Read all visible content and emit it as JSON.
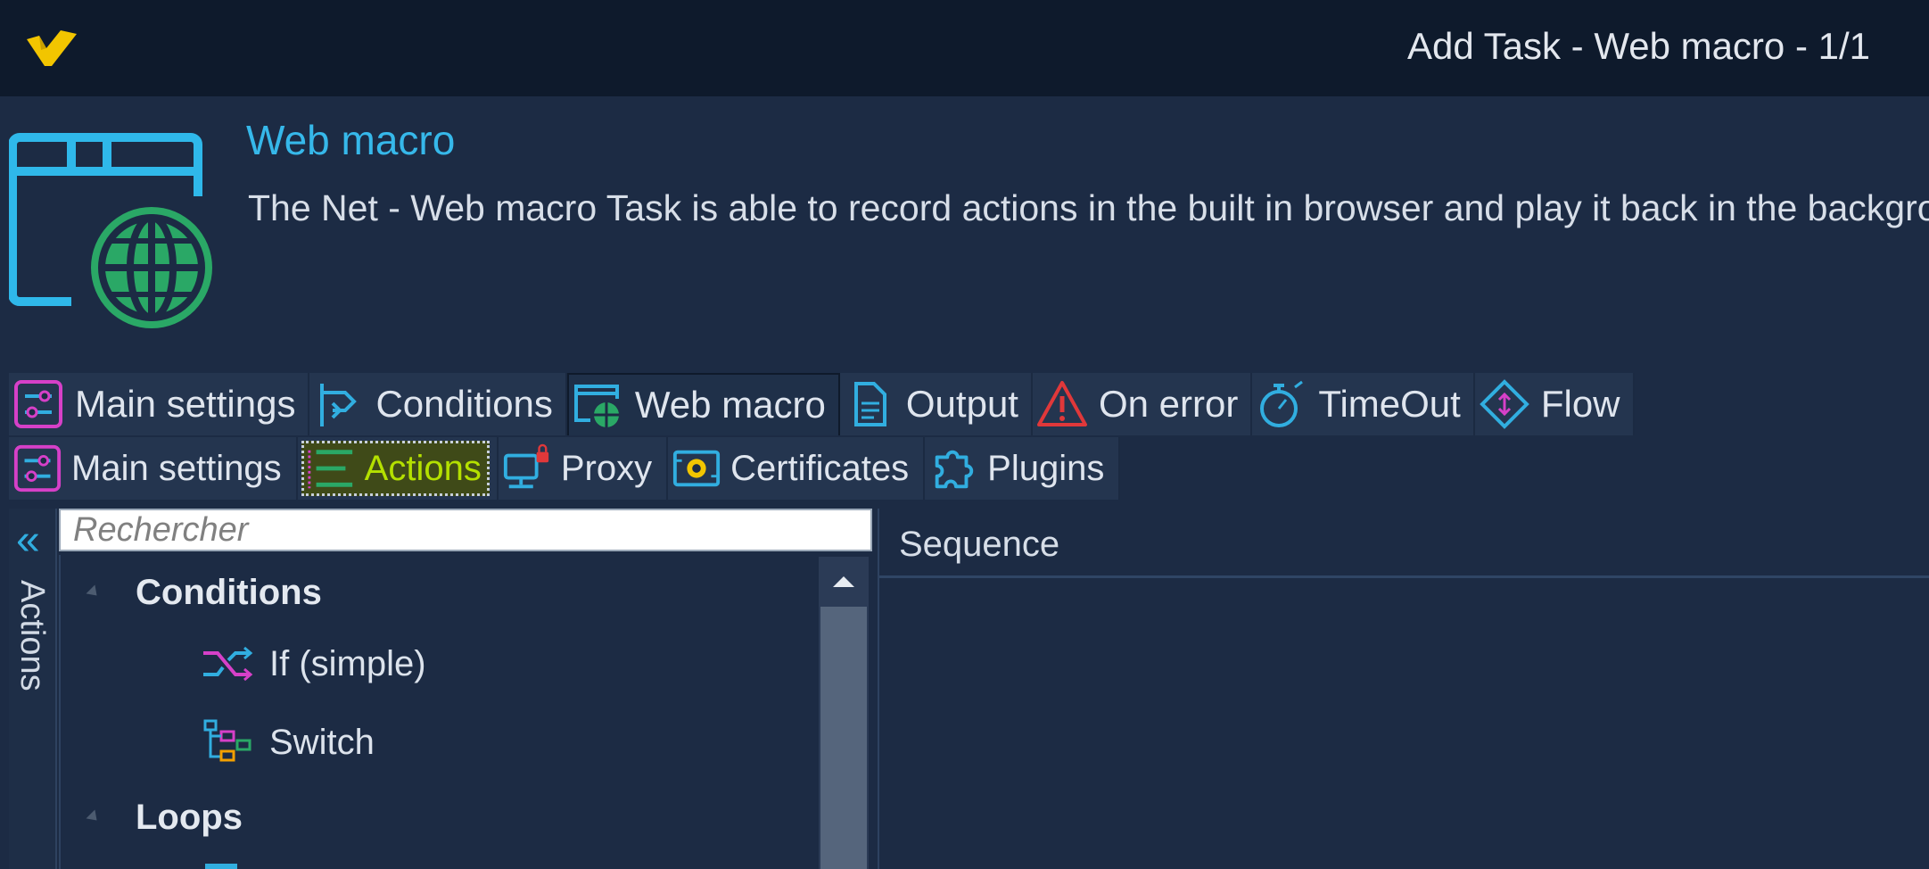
{
  "window": {
    "title": "Add Task - Web macro - 1/1"
  },
  "header": {
    "title": "Web macro",
    "description": "The Net - Web macro Task is able to record actions in the built in browser and play it back in the backgro",
    "icon": "browser-globe-icon"
  },
  "tabs_primary": [
    {
      "label": "Main settings",
      "icon": "sliders-icon"
    },
    {
      "label": "Conditions",
      "icon": "branch-icon"
    },
    {
      "label": "Web macro",
      "icon": "browser-globe-icon",
      "active": true
    },
    {
      "label": "Output",
      "icon": "document-icon"
    },
    {
      "label": "On error",
      "icon": "warning-icon"
    },
    {
      "label": "TimeOut",
      "icon": "stopwatch-icon"
    },
    {
      "label": "Flow",
      "icon": "diamond-arrows-icon"
    }
  ],
  "tabs_secondary": [
    {
      "label": "Main settings",
      "icon": "sliders-icon"
    },
    {
      "label": "Actions",
      "icon": "actions-list-icon",
      "active": true
    },
    {
      "label": "Proxy",
      "icon": "proxy-lock-icon"
    },
    {
      "label": "Certificates",
      "icon": "certificate-icon"
    },
    {
      "label": "Plugins",
      "icon": "puzzle-icon"
    }
  ],
  "side_panel": {
    "label": "Actions",
    "collapse_icon": "double-chevron-left-icon"
  },
  "search": {
    "placeholder": "Rechercher",
    "value": ""
  },
  "tree": {
    "categories": [
      {
        "label": "Conditions",
        "items": [
          {
            "label": "If (simple)",
            "icon": "shuffle-icon"
          },
          {
            "label": "Switch",
            "icon": "switch-icon"
          }
        ]
      },
      {
        "label": "Loops",
        "items": []
      }
    ]
  },
  "sequence": {
    "title": "Sequence"
  },
  "colors": {
    "accent": "#36b8ea",
    "titlebar": "#0e1a2c",
    "background": "#1c2b44",
    "active_highlight": "#b4e000",
    "brand_yellow": "#f2c500"
  }
}
